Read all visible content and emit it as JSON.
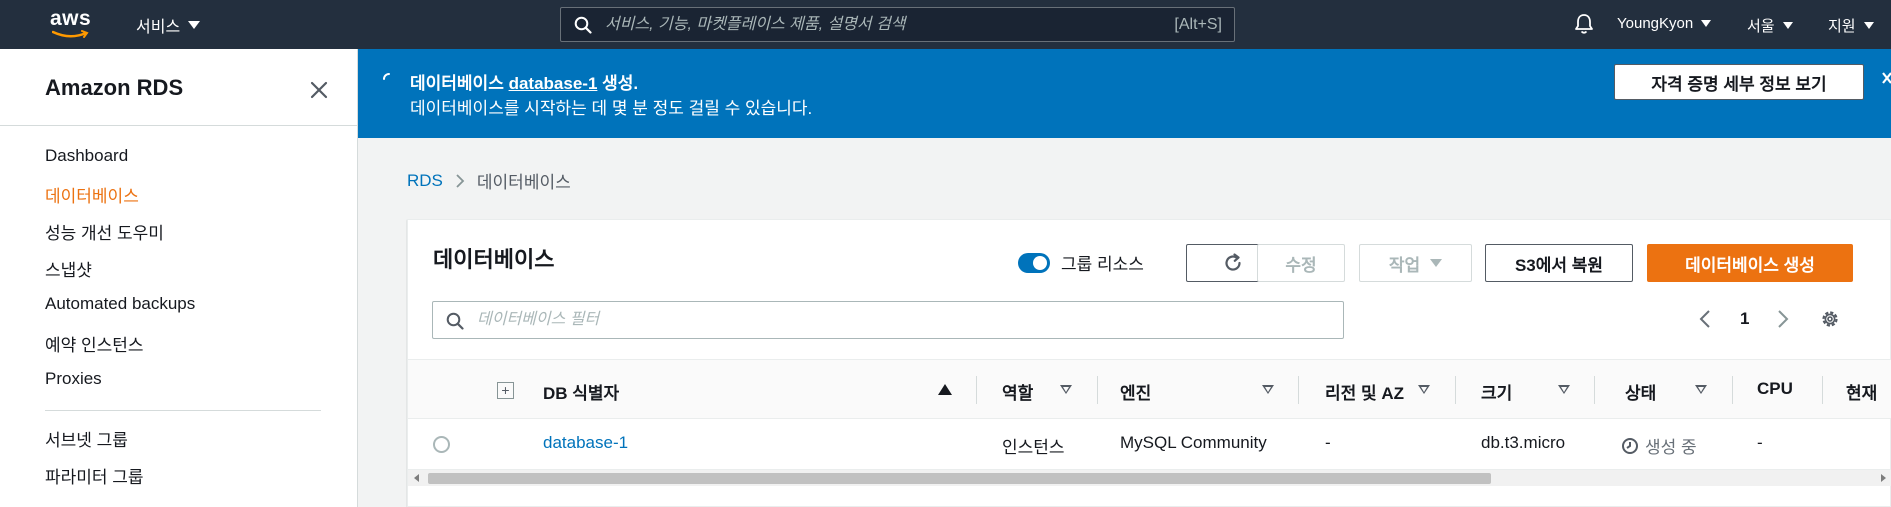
{
  "topnav": {
    "logo_text": "aws",
    "services_label": "서비스",
    "search_placeholder": "서비스, 기능, 마켓플레이스 제품, 설명서 검색",
    "search_shortcut": "[Alt+S]",
    "user": "YoungKyon",
    "region": "서울",
    "support": "지원",
    "colors": {
      "bg": "#232f3e",
      "accent": "#ff9900"
    }
  },
  "sidebar": {
    "title": "Amazon RDS",
    "items": [
      {
        "label": "Dashboard",
        "active": false
      },
      {
        "label": "데이터베이스",
        "active": true
      },
      {
        "label": "성능 개선 도우미",
        "active": false
      },
      {
        "label": "스냅샷",
        "active": false
      },
      {
        "label": "Automated backups",
        "active": false
      },
      {
        "label": "예약 인스턴스",
        "active": false
      },
      {
        "label": "Proxies",
        "active": false
      }
    ],
    "items2": [
      {
        "label": "서브넷 그룹"
      },
      {
        "label": "파라미터 그룹"
      }
    ]
  },
  "flash": {
    "title_prefix": "데이터베이스",
    "title_link": "database-1",
    "title_suffix": "생성.",
    "message": "데이터베이스를 시작하는 데 몇 분 정도 걸릴 수 있습니다.",
    "button": "자격 증명 세부 정보 보기",
    "color": "#0073bb"
  },
  "breadcrumb": {
    "root": "RDS",
    "current": "데이터베이스"
  },
  "panel": {
    "title": "데이터베이스",
    "group_toggle_label": "그룹 리소스",
    "edit_label": "수정",
    "actions_label": "작업",
    "restore_label": "S3에서 복원",
    "create_label": "데이터베이스 생성",
    "filter_placeholder": "데이터베이스 필터",
    "page": "1",
    "create_color": "#ec7211"
  },
  "table": {
    "headers": {
      "identifier": "DB 식별자",
      "role": "역할",
      "engine": "엔진",
      "region": "리전 및 AZ",
      "size": "크기",
      "status": "상태",
      "cpu": "CPU",
      "current": "현재"
    },
    "rows": [
      {
        "identifier": "database-1",
        "role": "인스턴스",
        "engine": "MySQL Community",
        "region": "-",
        "size": "db.t3.micro",
        "status": "생성 중",
        "cpu": "-"
      }
    ]
  }
}
